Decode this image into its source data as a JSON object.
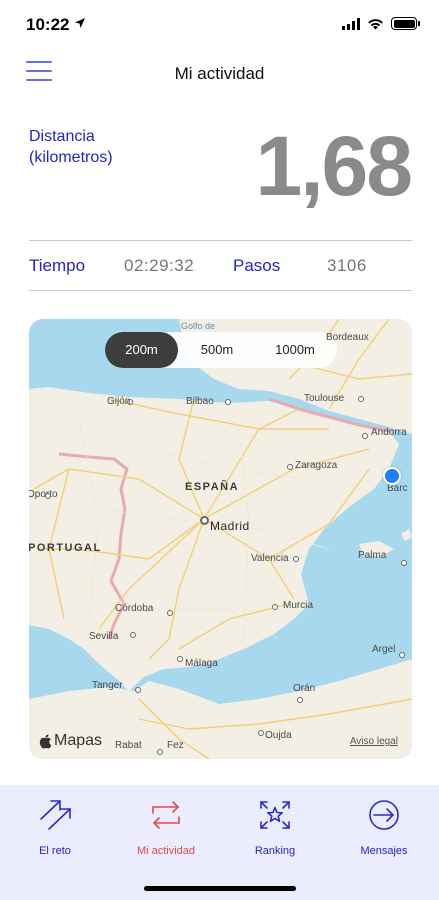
{
  "status_bar": {
    "time": "10:22",
    "icons": [
      "location-arrow-icon",
      "cellular-signal-icon",
      "wifi-icon",
      "battery-icon"
    ]
  },
  "header": {
    "title": "Mi actividad",
    "menu_icon": "hamburger-menu-icon"
  },
  "distance": {
    "label": "Distancia (kilometros)",
    "value": "1,68"
  },
  "stats": {
    "time_label": "Tiempo",
    "time_value": "02:29:32",
    "steps_label": "Pasos",
    "steps_value": "3106"
  },
  "map": {
    "scale_options": [
      "200m",
      "500m",
      "1000m"
    ],
    "selected_scale": "200m",
    "countries": [
      "ESPAÑA",
      "PORTUGAL"
    ],
    "capital": "Madrid",
    "seas": [
      "Golfo de"
    ],
    "cities": [
      "Bordeaux",
      "Gijón",
      "Bilbao",
      "Toulouse",
      "Andorra",
      "Zaragoza",
      "Oporto",
      "Valencia",
      "Palma",
      "Córdoba",
      "Murcia",
      "Sevilla",
      "Málaga",
      "Tanger",
      "Orán",
      "Argel",
      "Oujda",
      "Rabat",
      "Fez",
      "Barc"
    ],
    "attribution": "Mapas",
    "legal": "Aviso legal",
    "colors": {
      "water": "#a8d8ee",
      "land": "#f3efe4",
      "border": "#e8a8b4",
      "roads": "#f2cf72",
      "user_location": "#1f7dff"
    }
  },
  "tabs": [
    {
      "label": "El reto",
      "icon": "arrows-diagonal-icon",
      "active": false
    },
    {
      "label": "Mi actividad",
      "icon": "exchange-arrows-icon",
      "active": true
    },
    {
      "label": "Ranking",
      "icon": "star-focus-icon",
      "active": false
    },
    {
      "label": "Mensajes",
      "icon": "arrow-circle-icon",
      "active": false
    }
  ],
  "colors": {
    "accent_blue": "#2424c8",
    "active_red": "#e0484a",
    "value_gray": "#8a8a8a",
    "tab_bar_bg": "#ececff"
  }
}
